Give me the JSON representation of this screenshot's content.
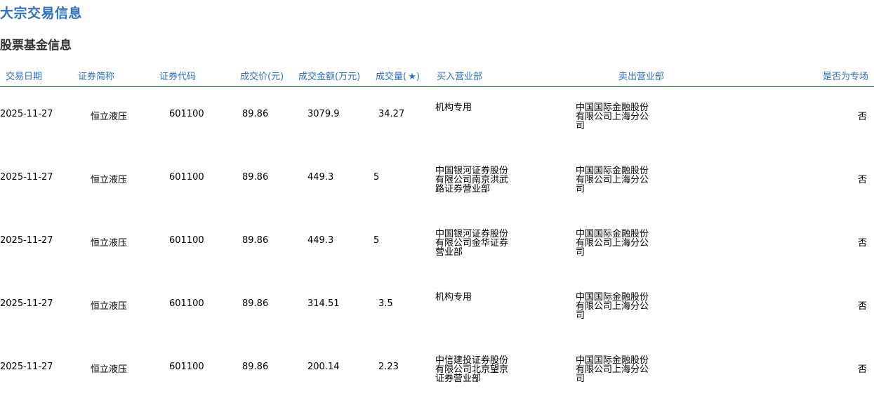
{
  "page_title": "大宗交易信息",
  "section_title": "股票基金信息",
  "table": {
    "headers": {
      "date": "交易日期",
      "name": "证券简称",
      "code": "证券代码",
      "price": "成交价(元)",
      "amount": "成交金额(万元)",
      "volume": "成交量( ★)",
      "buyer": "买入营业部",
      "seller": "卖出营业部",
      "special": "是否为专场"
    },
    "rows": [
      {
        "date": "2025-11-27",
        "name": "恒立液压",
        "code": "601100",
        "price": "89.86",
        "amount": "3079.9",
        "volume": "34.27",
        "buyer": "机构专用",
        "seller": "中国国际金融股份有限公司上海分公司",
        "special": "否"
      },
      {
        "date": "2025-11-27",
        "name": "恒立液压",
        "code": "601100",
        "price": "89.86",
        "amount": "449.3",
        "volume": "5",
        "buyer": "中国银河证券股份有限公司南京洪武路证券营业部",
        "seller": "中国国际金融股份有限公司上海分公司",
        "special": "否"
      },
      {
        "date": "2025-11-27",
        "name": "恒立液压",
        "code": "601100",
        "price": "89.86",
        "amount": "449.3",
        "volume": "5",
        "buyer": "中国银河证券股份有限公司金华证券营业部",
        "seller": "中国国际金融股份有限公司上海分公司",
        "special": "否"
      },
      {
        "date": "2025-11-27",
        "name": "恒立液压",
        "code": "601100",
        "price": "89.86",
        "amount": "314.51",
        "volume": "3.5",
        "buyer": "机构专用",
        "seller": "中国国际金融股份有限公司上海分公司",
        "special": "否"
      },
      {
        "date": "2025-11-27",
        "name": "恒立液压",
        "code": "601100",
        "price": "89.86",
        "amount": "200.14",
        "volume": "2.23",
        "buyer": "中信建投证券股份有限公司北京望京证券营业部",
        "seller": "中国国际金融股份有限公司上海分公司",
        "special": "否"
      }
    ]
  }
}
